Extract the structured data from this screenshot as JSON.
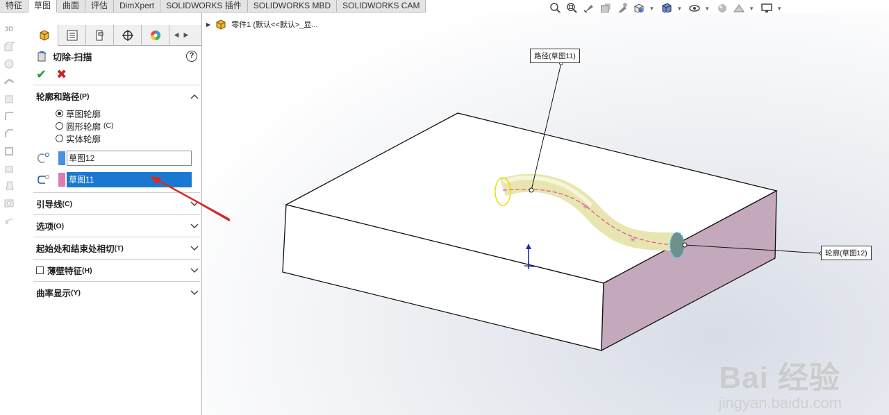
{
  "tabs": [
    "特征",
    "草图",
    "曲面",
    "评估",
    "DimXpert",
    "SOLIDWORKS 插件",
    "SOLIDWORKS MBD",
    "SOLIDWORKS CAM"
  ],
  "active_tab": "草图",
  "view_icons": [
    "zoom-to-fit-icon",
    "zoom-area-icon",
    "previous-view-icon",
    "section-view-icon",
    "dynamic-annotation-icon",
    "view-orientation-icon",
    "display-style-icon",
    "hide-show-items-icon",
    "edit-appearance-icon",
    "apply-scene-icon",
    "view-settings-icon"
  ],
  "left_strip": {
    "label_3d": "3D"
  },
  "panel": {
    "title": "切除-扫描",
    "help": "?",
    "ok": "✔",
    "cancel": "✖",
    "groups": {
      "profile_path": {
        "label": "轮廓和路径",
        "accel": "(P)"
      },
      "guide": {
        "label": "引导线",
        "accel": "(C)"
      },
      "options": {
        "label": "选项",
        "accel": "(O)"
      },
      "tangency": {
        "label": "起始处和结束处相切",
        "accel": "(T)"
      },
      "thin": {
        "label": "薄壁特征",
        "accel": "(H)"
      },
      "curvature": {
        "label": "曲率显示",
        "accel": "(Y)"
      }
    },
    "radios": [
      {
        "label": "草图轮廓",
        "accel": "",
        "checked": true
      },
      {
        "label": "圆形轮廓",
        "accel": "(C)",
        "checked": false
      },
      {
        "label": "实体轮廓",
        "accel": "",
        "checked": false
      }
    ],
    "profile_value": "草图12",
    "path_value": "草图11",
    "profile_color": "#4a90e2",
    "path_color": "#e07ab4"
  },
  "graphics": {
    "tree_label": "零件1  (默认<<默认>_显...",
    "callout_path": "路径(草图11)",
    "callout_profile": "轮廓(草图12)",
    "watermark": "Bai 经验",
    "watermark_sub": "jingyan.baidu.com"
  }
}
